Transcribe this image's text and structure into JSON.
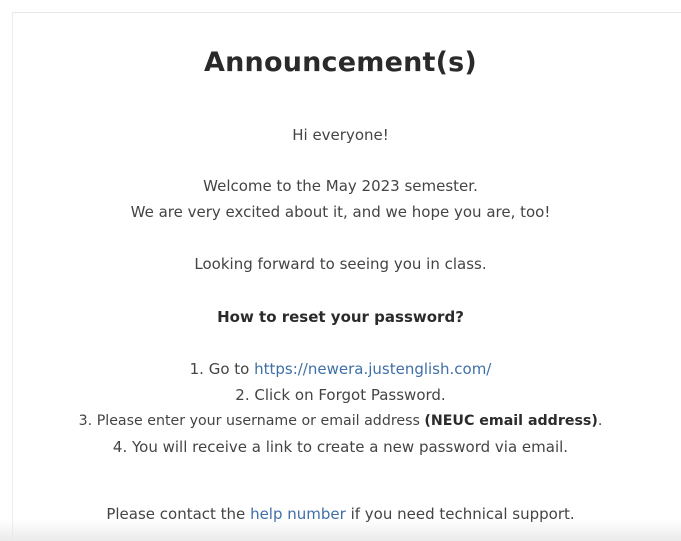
{
  "announcement": {
    "title": "Announcement(s)",
    "greeting": "Hi everyone!",
    "welcome_line1": "Welcome to the May 2023 semester.",
    "welcome_line2": "We are very excited about it, and we hope you are, too!",
    "looking_forward": "Looking forward to seeing you in class.",
    "reset_heading": "How to reset your password?",
    "steps": {
      "step1_prefix": "1. Go to ",
      "step1_link": "https://newera.justenglish.com/",
      "step2": "2. Click on Forgot Password.",
      "step3_prefix": "3. Please enter your username or email address ",
      "step3_bold": "(NEUC email address)",
      "step3_suffix": ".",
      "step4": "4. You will receive a link to create a new password via email."
    },
    "contact": {
      "prefix": "Please contact the ",
      "link": "help number",
      "suffix": " if you need technical support."
    }
  }
}
